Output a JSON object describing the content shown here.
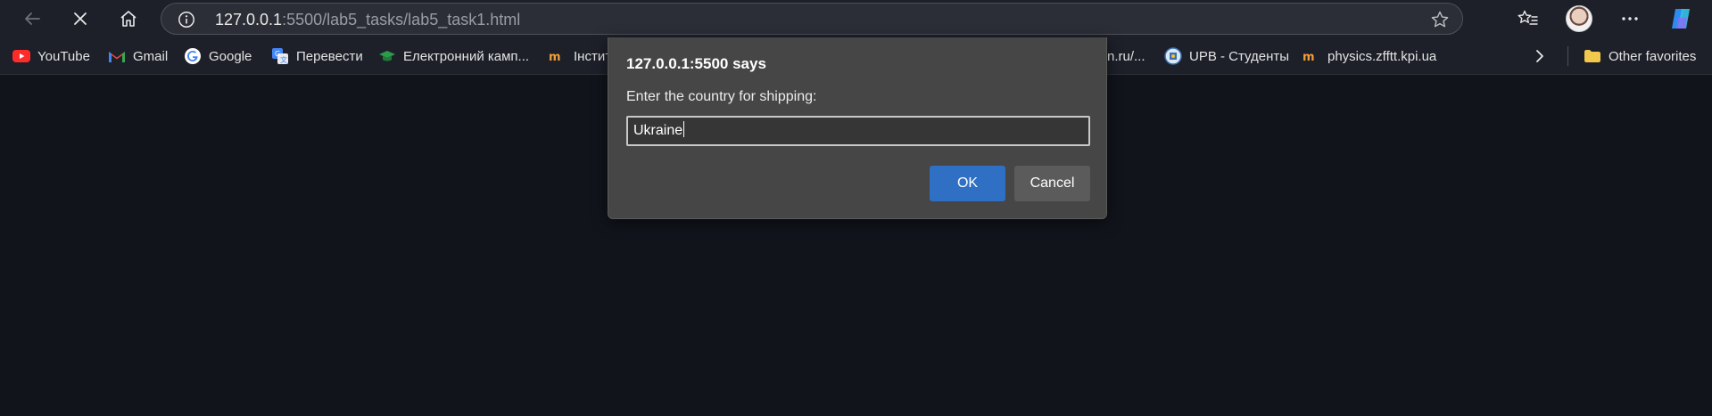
{
  "browser": {
    "url_host": "127.0.0.1",
    "url_path": ":5500/lab5_tasks/lab5_task1.html",
    "icons": {
      "back": "back-arrow-icon",
      "stop": "close-icon",
      "home": "home-icon",
      "info": "info-icon",
      "favorite": "star-icon",
      "favorites_list": "favorites-list-icon",
      "profile": "avatar",
      "menu": "more-icon",
      "copilot": "copilot-icon"
    }
  },
  "bookmarks": {
    "items": [
      {
        "label": "YouTube",
        "icon": "youtube-icon"
      },
      {
        "label": "Gmail",
        "icon": "gmail-icon"
      },
      {
        "label": "Google",
        "icon": "google-icon"
      },
      {
        "label": "Перевести",
        "icon": "translate-icon"
      },
      {
        "label": "Електронний камп...",
        "icon": "graduation-cap-icon"
      },
      {
        "label": "Інстит",
        "icon": "institute-icon"
      },
      {
        "label": "n.ru/...",
        "icon": ""
      },
      {
        "label": "UPB - Студенты",
        "icon": "upb-icon"
      },
      {
        "label": "physics.zfftt.kpi.ua",
        "icon": "institute-icon"
      }
    ],
    "more_icon": "chevron-right-icon",
    "other_favorites": "Other favorites"
  },
  "dialog": {
    "title": "127.0.0.1:5500 says",
    "message": "Enter the country for shipping:",
    "input_value": "Ukraine",
    "ok_label": "OK",
    "cancel_label": "Cancel"
  },
  "colors": {
    "page_background": "#11141b",
    "toolbar": "#1d2029",
    "dialog": "#464646",
    "ok_button": "#2f6fc4",
    "cancel_button": "#5b5b5b"
  }
}
